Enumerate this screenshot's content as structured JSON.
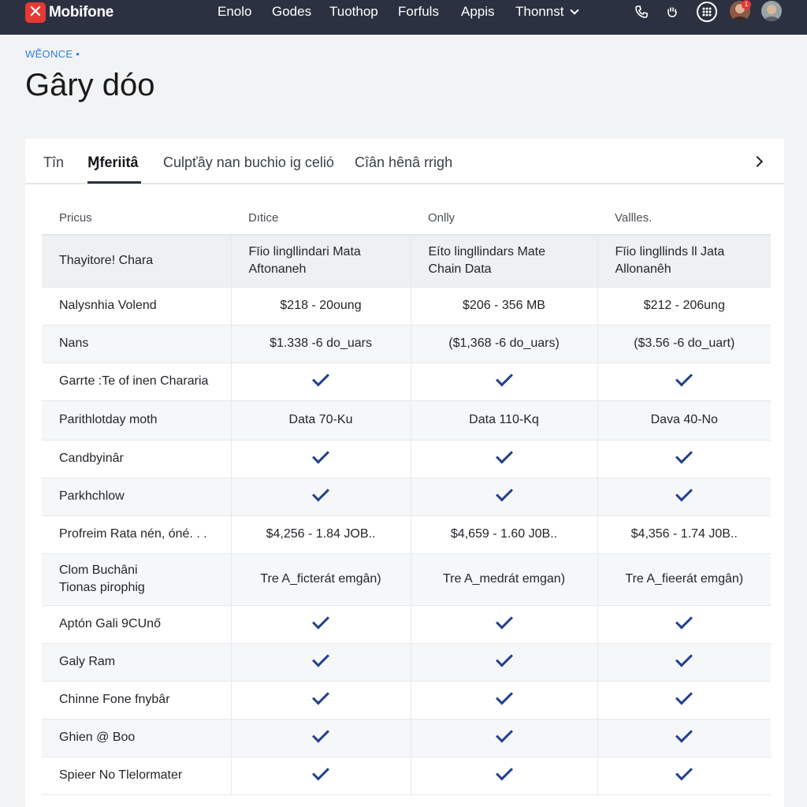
{
  "topbar": {
    "brand": "Mobifone",
    "nav": [
      "Enolo",
      "Godes",
      "Tuothop",
      "Forfuls",
      "Appis",
      "Thonnst"
    ],
    "icons": [
      "phone-icon",
      "hand-icon",
      "apps-grid-icon"
    ],
    "notification_count": "1"
  },
  "header": {
    "eyebrow": "WẼONCE •",
    "title": "Gâry dóo"
  },
  "tabs": [
    "Tîn",
    "Ɱferiitâ",
    "Culpťây nan buchio ig celió",
    "Cîân hênâ rrigh"
  ],
  "table": {
    "columns": [
      "Pricus",
      "Dıtice",
      "Onlly",
      "Vallles."
    ],
    "rows": [
      {
        "label": "Thayitore! Chara",
        "type": "text",
        "values": [
          [
            "Fīio lingllindari Mata",
            "Aftonaneh"
          ],
          [
            "Eíto lingllindars Mate",
            "Chain Data"
          ],
          [
            "Fīio lingllinds ll Jata",
            "Allonanêh"
          ]
        ]
      },
      {
        "label": "Nalysnhia Volend",
        "type": "text",
        "values": [
          "$218 - 20oung",
          "$206 - 356 MB",
          "$212 - 206ung"
        ]
      },
      {
        "label": "Nans",
        "type": "text",
        "values": [
          "$1.338 -6 do_uars",
          "($1,368 -6 do_uars)",
          "($3.56 -6 do_uart)"
        ]
      },
      {
        "label": "Garrte :Te of inen Chararia",
        "type": "check",
        "values": [
          true,
          true,
          true
        ]
      },
      {
        "label": "Parithlotday moth",
        "type": "text",
        "values": [
          "Data 70-Ku",
          "Data 110-Kq",
          "Dava 40-No"
        ]
      },
      {
        "label": "Candbyinâr",
        "type": "check",
        "values": [
          true,
          true,
          true
        ]
      },
      {
        "label": "Parkhchlow",
        "type": "check",
        "values": [
          true,
          true,
          true
        ]
      },
      {
        "label": "Profreim Rata nén, óné. . .",
        "type": "text",
        "values": [
          "$4,256 - 1.84 JOB..",
          "$4,659 - 1.60 J0B..",
          "$4,356 - 1.74 J0B.."
        ]
      },
      {
        "label": [
          "Clom Buchâni",
          "Tionas pirophig"
        ],
        "type": "text",
        "values": [
          "Tre A_ficterát emgân)",
          "Tre A_medrát emgan)",
          "Tre A_fieerát emgân)"
        ]
      },
      {
        "label": "Aptón Gali 9CUnő",
        "type": "check",
        "values": [
          true,
          true,
          true
        ]
      },
      {
        "label": "Galy Ram",
        "type": "check",
        "values": [
          true,
          true,
          true
        ]
      },
      {
        "label": "Chinne Fone fnybâr",
        "type": "check",
        "values": [
          true,
          true,
          true
        ]
      },
      {
        "label": "Ghien @ Boo",
        "type": "check",
        "values": [
          true,
          true,
          true
        ]
      },
      {
        "label": "Spieer No Tlelormater",
        "type": "check",
        "values": [
          true,
          true,
          true
        ]
      }
    ]
  },
  "colors": {
    "topbar": "#2b3140",
    "brand_red": "#e53935",
    "accent_blue": "#2f7fd6",
    "check": "#23408e"
  }
}
